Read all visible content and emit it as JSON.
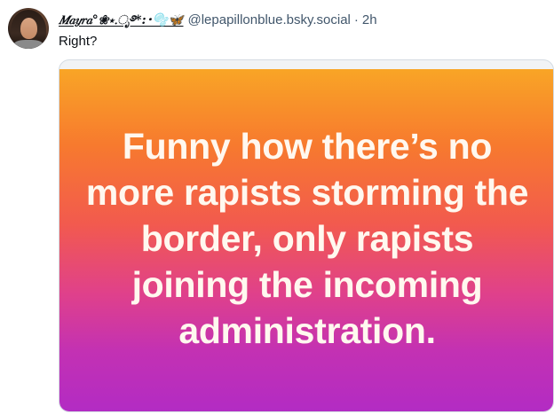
{
  "post": {
    "display_name": "𝑀𝑎𝑦𝑟𝑎°❀⋆.ೃ࿔*:･🫧🦋",
    "handle": "@lepapillonblue.bsky.social",
    "separator": "·",
    "time": "2h",
    "text": "Right?"
  },
  "embed": {
    "image_text": "Funny how there’s no more rapists storming the border, only rapists joining the incoming administration.",
    "gradient_colors": [
      "#f9a526",
      "#f77a2e",
      "#f25a4e",
      "#e0418a",
      "#c331b3",
      "#b22bc4"
    ]
  },
  "colors": {
    "text_primary": "#0b0f14",
    "text_secondary": "#42576c",
    "border": "#d4dbe2"
  }
}
